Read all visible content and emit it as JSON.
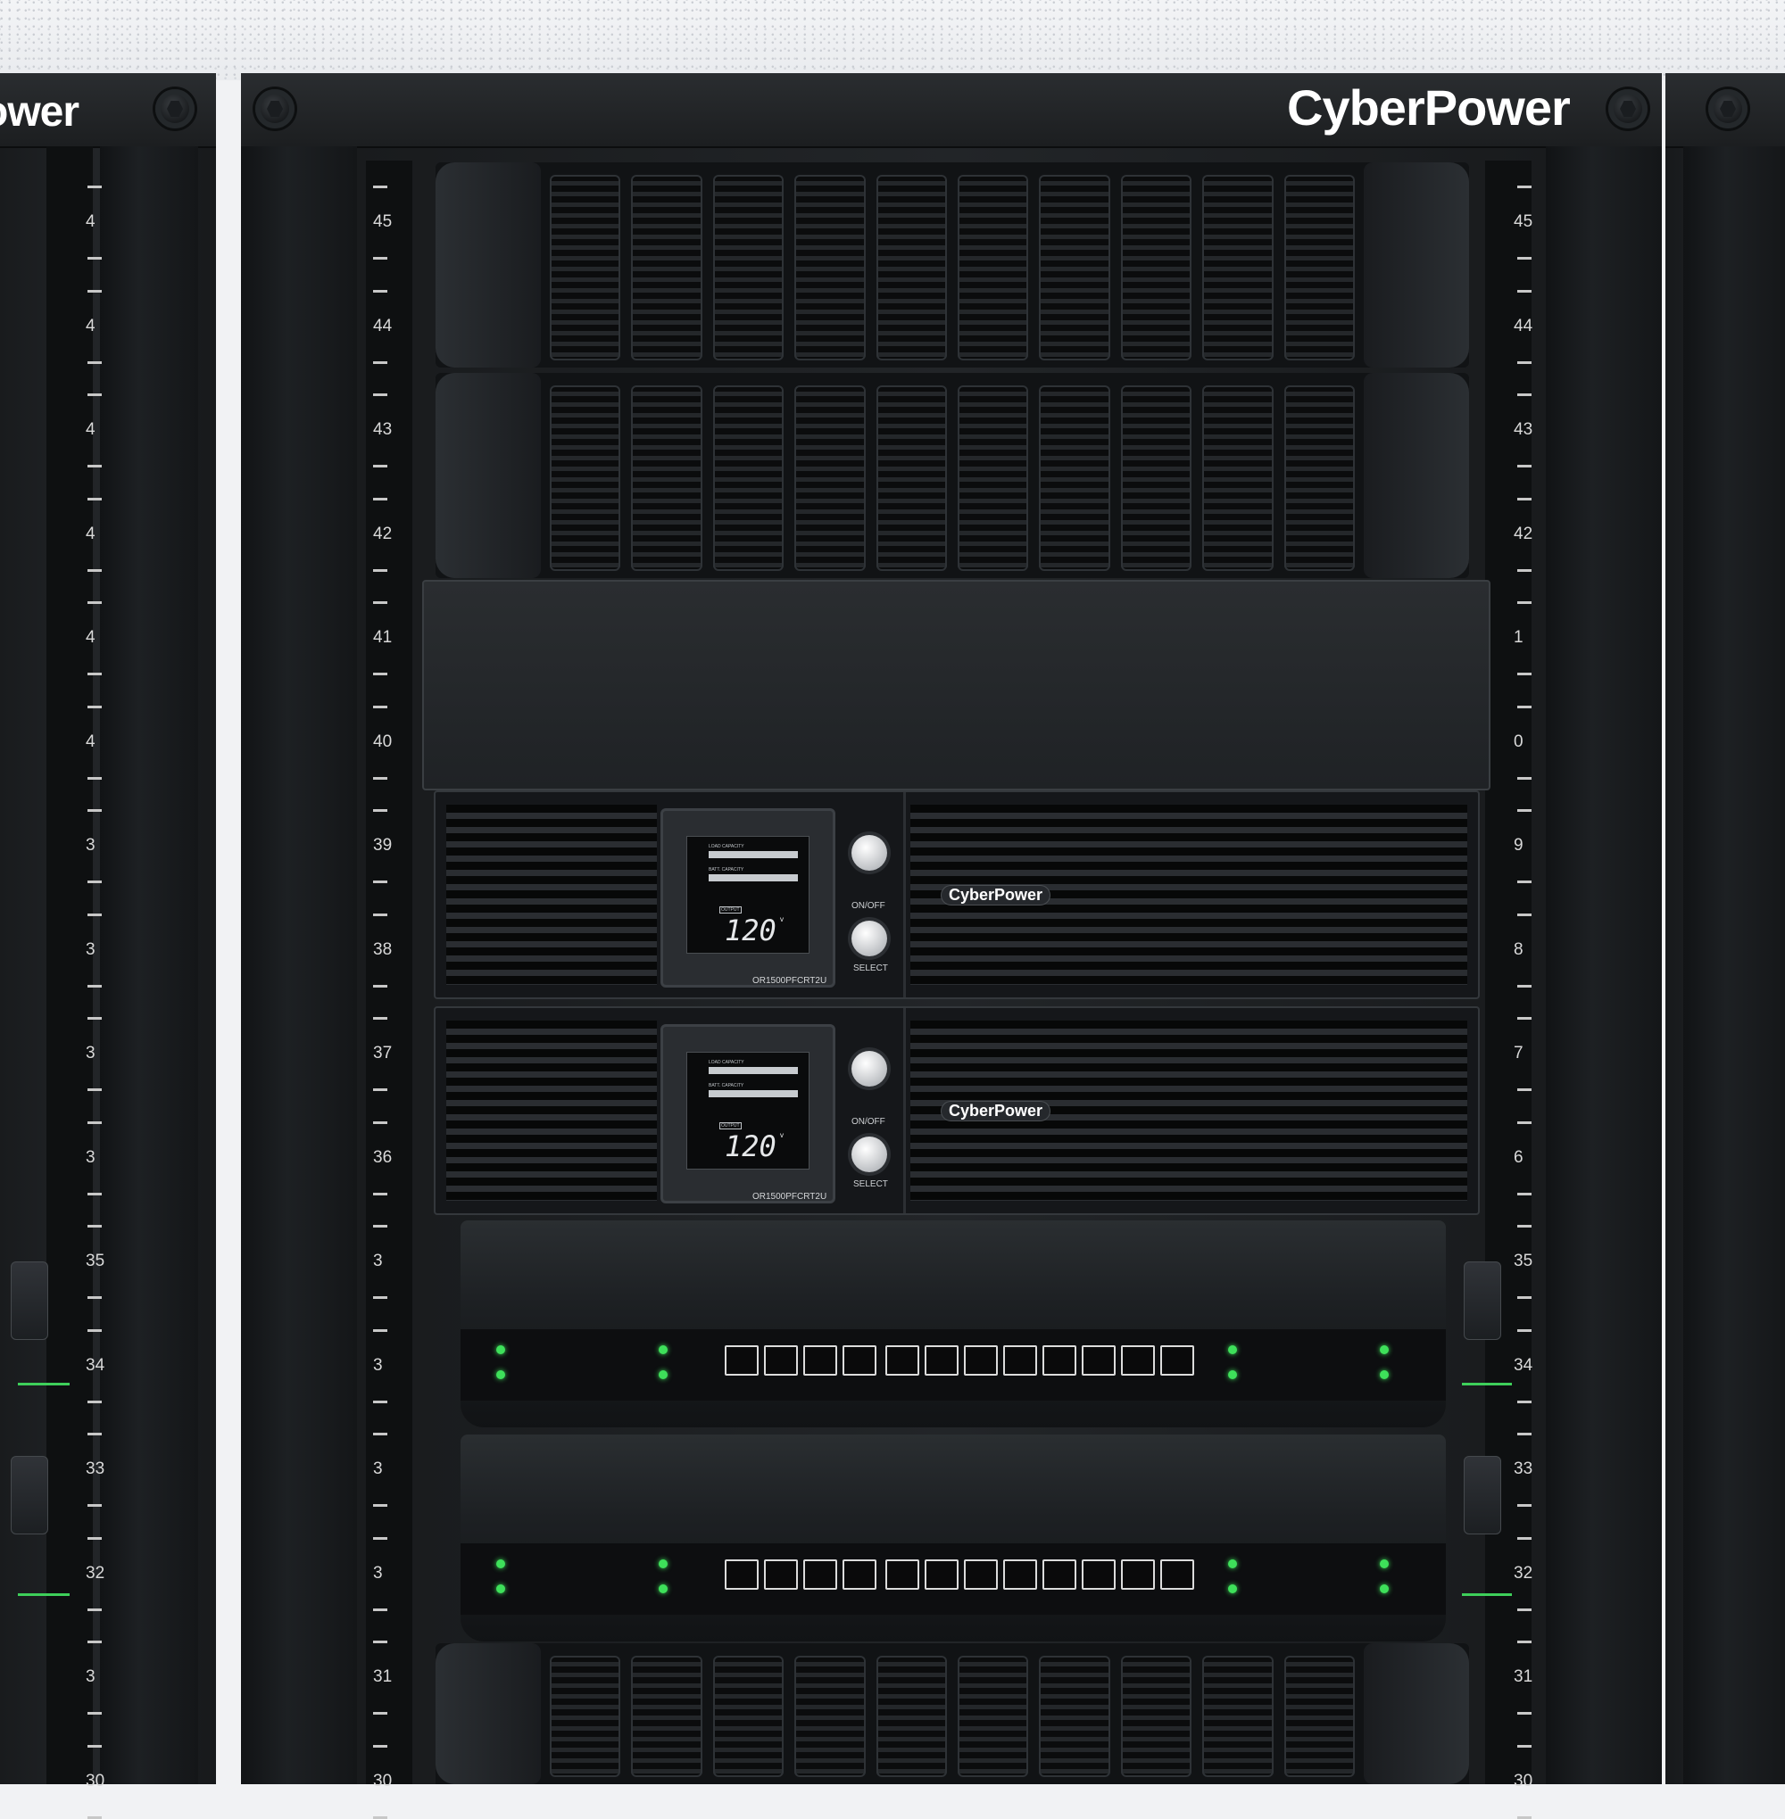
{
  "brand": {
    "rack_logo": "CyberPower",
    "left_rack_logo": "ower",
    "ups_logo": "CyberPower"
  },
  "rack_units": {
    "left_numbers": [
      "45",
      "44",
      "43",
      "42",
      "41",
      "40",
      "39",
      "38",
      "37",
      "36",
      "3",
      "3",
      "3",
      "3",
      "31",
      "30"
    ],
    "right_numbers": [
      "45",
      "44",
      "43",
      "42",
      "1",
      "0",
      "9",
      "8",
      "7",
      "6",
      "35",
      "34",
      "33",
      "32",
      "31",
      "30"
    ]
  },
  "left_rack_numbers": [
    "4",
    "4",
    "4",
    "4",
    "4",
    "4",
    "3",
    "3",
    "3",
    "3",
    "35",
    "34",
    "33",
    "32",
    "3",
    "30"
  ],
  "ups_units": [
    {
      "model": "OR1500PFCRT2U",
      "output_label": "OUTPUT",
      "output_value": "120",
      "output_unit": "v",
      "load_label": "LOAD CAPACITY",
      "batt_label": "BATT. CAPACITY",
      "on_off_label": "ON/OFF",
      "select_label": "SELECT"
    },
    {
      "model": "OR1500PFCRT2U",
      "output_label": "OUTPUT",
      "output_value": "120",
      "output_unit": "v",
      "load_label": "LOAD CAPACITY",
      "batt_label": "BATT. CAPACITY",
      "on_off_label": "ON/OFF",
      "select_label": "SELECT"
    }
  ],
  "colors": {
    "rack": "#1e2124",
    "led_green": "#3ee05a",
    "wall": "#f1f2f4"
  }
}
